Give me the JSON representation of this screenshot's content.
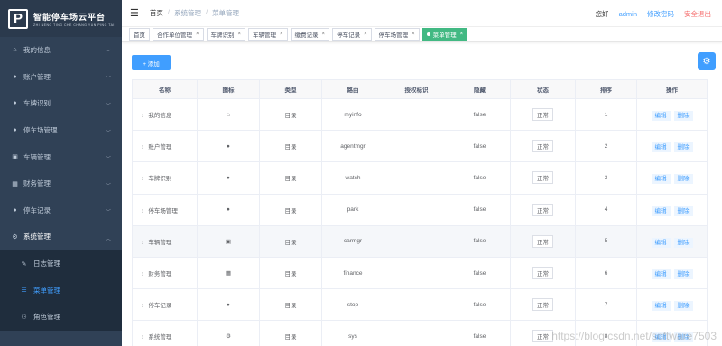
{
  "logo": {
    "title": "智能停车场云平台",
    "subtitle": "ZHI NENG TING CHE CHANG YUN PING TAI",
    "letter": "P"
  },
  "sidebar": {
    "items": [
      {
        "label": "我的信息",
        "icon": "home-icon",
        "glyph": "⌂"
      },
      {
        "label": "账户管理",
        "icon": "user-icon",
        "glyph": "●"
      },
      {
        "label": "车牌识别",
        "icon": "user-icon",
        "glyph": "●"
      },
      {
        "label": "停车场管理",
        "icon": "user-icon",
        "glyph": "●"
      },
      {
        "label": "车辆管理",
        "icon": "id-card-icon",
        "glyph": "▣"
      },
      {
        "label": "财务管理",
        "icon": "table-icon",
        "glyph": "▦"
      },
      {
        "label": "停车记录",
        "icon": "user-icon",
        "glyph": "●"
      },
      {
        "label": "系统管理",
        "icon": "gear-icon",
        "glyph": "⚙"
      }
    ],
    "submenu": [
      {
        "label": "日志管理",
        "icon": "log-icon",
        "glyph": "✎"
      },
      {
        "label": "菜单管理",
        "icon": "list-icon",
        "glyph": "☰"
      },
      {
        "label": "角色管理",
        "icon": "users-icon",
        "glyph": "⚇"
      }
    ]
  },
  "header": {
    "breadcrumb": [
      "首页",
      "系统管理",
      "菜单管理"
    ],
    "greeting": "您好",
    "user": "admin",
    "change_password": "修改密码",
    "logout": "安全退出"
  },
  "tags": [
    {
      "label": "首页",
      "closable": false
    },
    {
      "label": "合作单位管理",
      "closable": true
    },
    {
      "label": "车牌识别",
      "closable": true
    },
    {
      "label": "车辆管理",
      "closable": true
    },
    {
      "label": "缴费记录",
      "closable": true
    },
    {
      "label": "停车记录",
      "closable": true
    },
    {
      "label": "停车场管理",
      "closable": true
    },
    {
      "label": "菜单管理",
      "closable": true,
      "active": true
    }
  ],
  "toolbar": {
    "add_label": "+ 添加"
  },
  "table": {
    "headers": [
      "名称",
      "图标",
      "类型",
      "路由",
      "授权标识",
      "隐藏",
      "状态",
      "排序",
      "操作"
    ],
    "edit_label": "编辑",
    "delete_label": "删除",
    "rows": [
      {
        "name": "我的信息",
        "icon_glyph": "⌂",
        "icon": "home-icon",
        "type": "目录",
        "route": "myinfo",
        "perm": "",
        "hidden": "false",
        "status": "正常",
        "sort": "1"
      },
      {
        "name": "账户管理",
        "icon_glyph": "●",
        "icon": "user-icon",
        "type": "目录",
        "route": "agentmgr",
        "perm": "",
        "hidden": "false",
        "status": "正常",
        "sort": "2"
      },
      {
        "name": "车牌识别",
        "icon_glyph": "●",
        "icon": "user-icon",
        "type": "目录",
        "route": "watch",
        "perm": "",
        "hidden": "false",
        "status": "正常",
        "sort": "3"
      },
      {
        "name": "停车场管理",
        "icon_glyph": "●",
        "icon": "user-icon",
        "type": "目录",
        "route": "park",
        "perm": "",
        "hidden": "false",
        "status": "正常",
        "sort": "4"
      },
      {
        "name": "车辆管理",
        "icon_glyph": "▣",
        "icon": "id-card-icon",
        "type": "目录",
        "route": "carmgr",
        "perm": "",
        "hidden": "false",
        "status": "正常",
        "sort": "5"
      },
      {
        "name": "财务管理",
        "icon_glyph": "▦",
        "icon": "table-icon",
        "type": "目录",
        "route": "finance",
        "perm": "",
        "hidden": "false",
        "status": "正常",
        "sort": "6"
      },
      {
        "name": "停车记录",
        "icon_glyph": "●",
        "icon": "user-icon",
        "type": "目录",
        "route": "stop",
        "perm": "",
        "hidden": "false",
        "status": "正常",
        "sort": "7"
      },
      {
        "name": "系统管理",
        "icon_glyph": "⚙",
        "icon": "gear-icon",
        "type": "目录",
        "route": "sys",
        "perm": "",
        "hidden": "false",
        "status": "正常",
        "sort": "8"
      }
    ]
  },
  "watermark": "https://blog.csdn.net/software7503"
}
